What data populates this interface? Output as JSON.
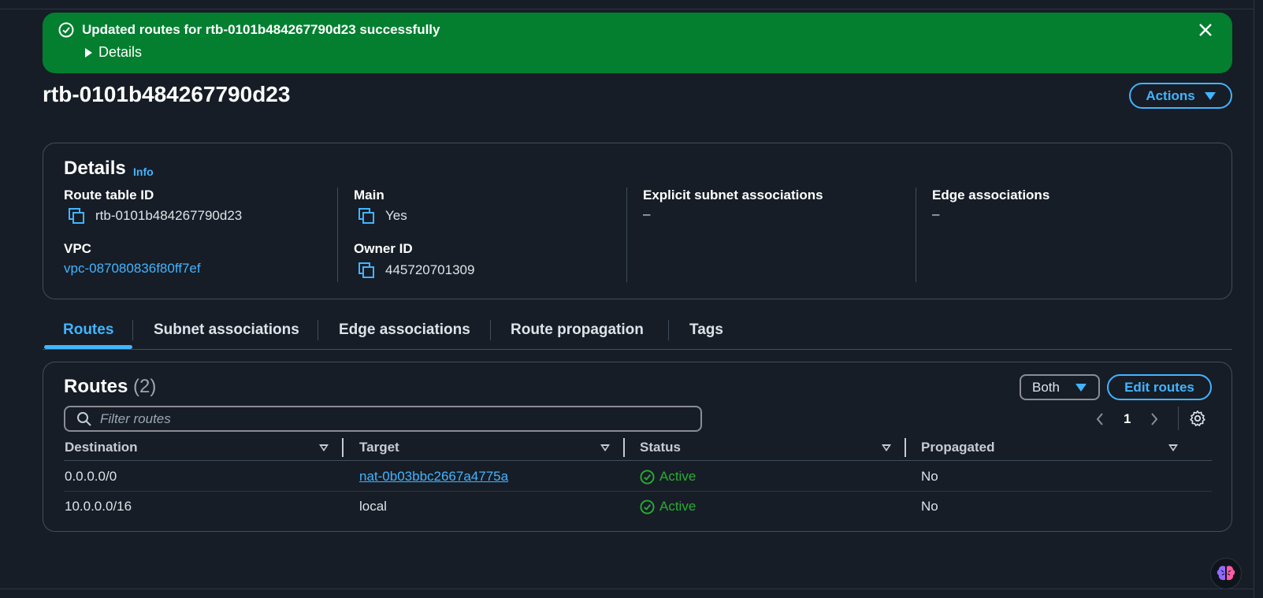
{
  "flash": {
    "message": "Updated routes for rtb-0101b484267790d23 successfully",
    "details_label": "Details",
    "color": "#037f2f"
  },
  "header": {
    "title": "rtb-0101b484267790d23",
    "actions_label": "Actions"
  },
  "details": {
    "title": "Details",
    "info_label": "Info",
    "route_table_id": {
      "label": "Route table ID",
      "value": "rtb-0101b484267790d23"
    },
    "main": {
      "label": "Main",
      "value": "Yes"
    },
    "explicit_subnet": {
      "label": "Explicit subnet associations",
      "value": "–"
    },
    "edge": {
      "label": "Edge associations",
      "value": "–"
    },
    "vpc": {
      "label": "VPC",
      "value": "vpc-087080836f80ff7ef"
    },
    "owner": {
      "label": "Owner ID",
      "value": "445720701309"
    }
  },
  "tabs": [
    {
      "label": "Routes",
      "active": true
    },
    {
      "label": "Subnet associations",
      "active": false
    },
    {
      "label": "Edge associations",
      "active": false
    },
    {
      "label": "Route propagation",
      "active": false
    },
    {
      "label": "Tags",
      "active": false
    }
  ],
  "routes": {
    "title": "Routes",
    "count": "(2)",
    "filter_select": "Both",
    "edit_label": "Edit routes",
    "filter_placeholder": "Filter routes",
    "page": "1",
    "columns": [
      "Destination",
      "Target",
      "Status",
      "Propagated"
    ],
    "rows": [
      {
        "destination": "0.0.0.0/0",
        "target": "nat-0b03bbc2667a4775a",
        "status": "Active",
        "propagated": "No"
      },
      {
        "destination": "10.0.0.0/16",
        "target": "local",
        "status": "Active",
        "propagated": "No"
      }
    ]
  },
  "colors": {
    "accent": "#42b4ff",
    "success": "#29ad32",
    "background": "#161d26"
  }
}
